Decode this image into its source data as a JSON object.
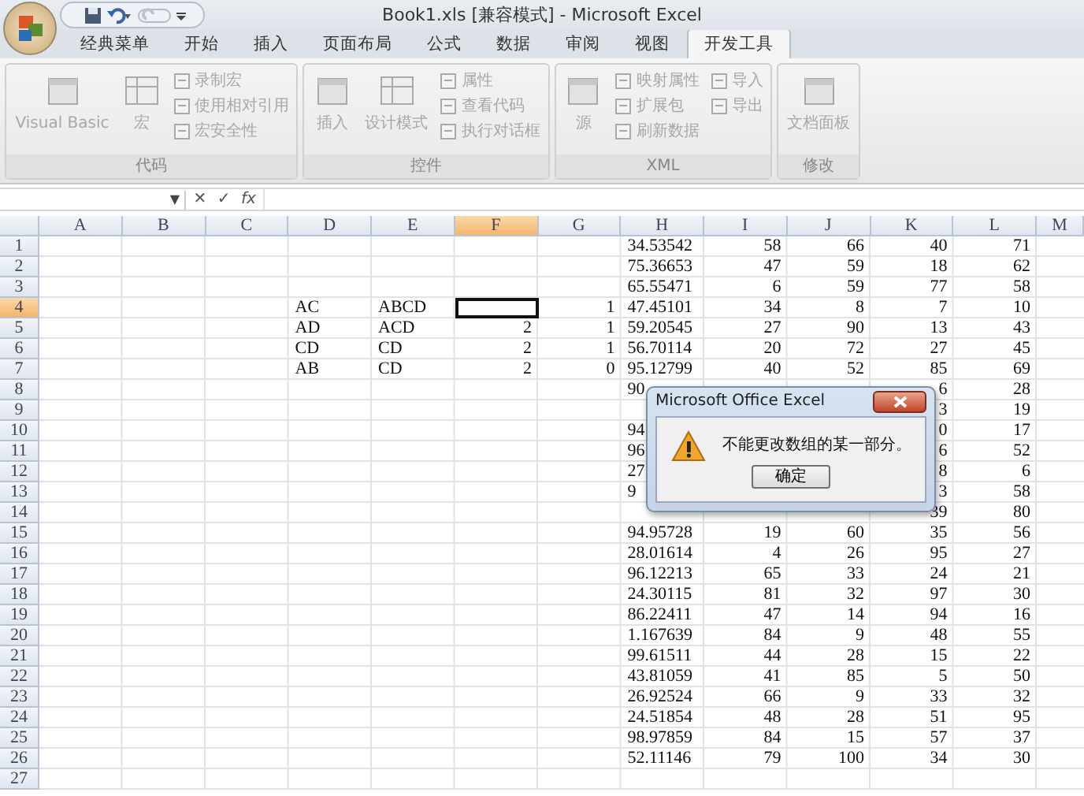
{
  "window": {
    "title": "Book1.xls  [兼容模式] - Microsoft Excel"
  },
  "tabs": [
    {
      "label": "经典菜单",
      "selected": false
    },
    {
      "label": "开始",
      "selected": false
    },
    {
      "label": "插入",
      "selected": false
    },
    {
      "label": "页面布局",
      "selected": false
    },
    {
      "label": "公式",
      "selected": false
    },
    {
      "label": "数据",
      "selected": false
    },
    {
      "label": "审阅",
      "selected": false
    },
    {
      "label": "视图",
      "selected": false
    },
    {
      "label": "开发工具",
      "selected": true
    }
  ],
  "ribbon": [
    {
      "title": "代码",
      "items": [
        {
          "label": "Visual Basic",
          "kind": "large",
          "disabled": true
        },
        {
          "label": "宏",
          "kind": "large",
          "disabled": true
        },
        {
          "label": "录制宏",
          "kind": "small",
          "disabled": true
        },
        {
          "label": "使用相对引用",
          "kind": "small",
          "disabled": true
        },
        {
          "label": "宏安全性",
          "kind": "small",
          "disabled": true
        }
      ]
    },
    {
      "title": "控件",
      "items": [
        {
          "label": "插入",
          "kind": "large",
          "disabled": true
        },
        {
          "label": "设计模式",
          "kind": "large",
          "disabled": true
        },
        {
          "label": "属性",
          "kind": "small",
          "disabled": true
        },
        {
          "label": "查看代码",
          "kind": "small",
          "disabled": true
        },
        {
          "label": "执行对话框",
          "kind": "small",
          "disabled": true
        }
      ]
    },
    {
      "title": "XML",
      "items": [
        {
          "label": "源",
          "kind": "large",
          "disabled": true
        },
        {
          "label": "映射属性",
          "kind": "small",
          "disabled": true
        },
        {
          "label": "扩展包",
          "kind": "small",
          "disabled": true
        },
        {
          "label": "刷新数据",
          "kind": "small",
          "disabled": true
        },
        {
          "label": "导入",
          "kind": "small",
          "disabled": true
        },
        {
          "label": "导出",
          "kind": "small",
          "disabled": true
        }
      ]
    },
    {
      "title": "修改",
      "items": [
        {
          "label": "文档面板",
          "kind": "large",
          "disabled": true
        }
      ]
    }
  ],
  "formula_bar": {
    "dropdown": "▼",
    "cancel": "✕",
    "enter": "✓",
    "fx": "fx"
  },
  "columns": [
    {
      "label": "A",
      "selected": false
    },
    {
      "label": "B",
      "selected": false
    },
    {
      "label": "C",
      "selected": false
    },
    {
      "label": "D",
      "selected": false
    },
    {
      "label": "E",
      "selected": false
    },
    {
      "label": "F",
      "selected": true
    },
    {
      "label": "G",
      "selected": false
    },
    {
      "label": "H",
      "selected": false
    },
    {
      "label": "I",
      "selected": false
    },
    {
      "label": "J",
      "selected": false
    },
    {
      "label": "K",
      "selected": false
    },
    {
      "label": "L",
      "selected": false
    },
    {
      "label": "M",
      "selected": false
    }
  ],
  "rows": [
    {
      "label": "1",
      "selected": false,
      "cells": {
        "H": "34.53542",
        "I": "58",
        "J": "66",
        "K": "40",
        "L": "71"
      }
    },
    {
      "label": "2",
      "selected": false,
      "cells": {
        "H": "75.36653",
        "I": "47",
        "J": "59",
        "K": "18",
        "L": "62"
      }
    },
    {
      "label": "3",
      "selected": false,
      "cells": {
        "H": "65.55471",
        "I": "6",
        "J": "59",
        "K": "77",
        "L": "58"
      }
    },
    {
      "label": "4",
      "selected": true,
      "cells": {
        "D": "AC",
        "E": "ABCD",
        "G": "1",
        "H": "47.45101",
        "I": "34",
        "J": "8",
        "K": "7",
        "L": "10"
      }
    },
    {
      "label": "5",
      "selected": false,
      "cells": {
        "D": "AD",
        "E": "ACD",
        "F": "2",
        "G": "1",
        "H": "59.20545",
        "I": "27",
        "J": "90",
        "K": "13",
        "L": "43"
      }
    },
    {
      "label": "6",
      "selected": false,
      "cells": {
        "D": "CD",
        "E": "CD",
        "F": "2",
        "G": "1",
        "H": "56.70114",
        "I": "20",
        "J": "72",
        "K": "27",
        "L": "45"
      }
    },
    {
      "label": "7",
      "selected": false,
      "cells": {
        "D": "AB",
        "E": "CD",
        "F": "2",
        "G": "0",
        "H": "95.12799",
        "I": "40",
        "J": "52",
        "K": "85",
        "L": "69"
      }
    },
    {
      "label": "8",
      "selected": false,
      "cells": {
        "H": "90",
        "K": "6",
        "L": "28"
      }
    },
    {
      "label": "9",
      "selected": false,
      "cells": {
        "K": "3",
        "L": "19"
      }
    },
    {
      "label": "10",
      "selected": false,
      "cells": {
        "H": "94",
        "K": "0",
        "L": "17"
      }
    },
    {
      "label": "11",
      "selected": false,
      "cells": {
        "H": "96",
        "K": "6",
        "L": "52"
      }
    },
    {
      "label": "12",
      "selected": false,
      "cells": {
        "H": "27",
        "K": "8",
        "L": "6"
      }
    },
    {
      "label": "13",
      "selected": false,
      "cells": {
        "H": "9",
        "K": "3",
        "L": "58"
      }
    },
    {
      "label": "14",
      "selected": false,
      "cells": {
        "K": "39",
        "L": "80"
      }
    },
    {
      "label": "15",
      "selected": false,
      "cells": {
        "H": "94.95728",
        "I": "19",
        "J": "60",
        "K": "35",
        "L": "56"
      }
    },
    {
      "label": "16",
      "selected": false,
      "cells": {
        "H": "28.01614",
        "I": "4",
        "J": "26",
        "K": "95",
        "L": "27"
      }
    },
    {
      "label": "17",
      "selected": false,
      "cells": {
        "H": "96.12213",
        "I": "65",
        "J": "33",
        "K": "24",
        "L": "21"
      }
    },
    {
      "label": "18",
      "selected": false,
      "cells": {
        "H": "24.30115",
        "I": "81",
        "J": "32",
        "K": "97",
        "L": "30"
      }
    },
    {
      "label": "19",
      "selected": false,
      "cells": {
        "H": "86.22411",
        "I": "47",
        "J": "14",
        "K": "94",
        "L": "16"
      }
    },
    {
      "label": "20",
      "selected": false,
      "cells": {
        "H": "1.167639",
        "I": "84",
        "J": "9",
        "K": "48",
        "L": "55"
      }
    },
    {
      "label": "21",
      "selected": false,
      "cells": {
        "H": "99.61511",
        "I": "44",
        "J": "28",
        "K": "15",
        "L": "22"
      }
    },
    {
      "label": "22",
      "selected": false,
      "cells": {
        "H": "43.81059",
        "I": "41",
        "J": "85",
        "K": "5",
        "L": "50"
      }
    },
    {
      "label": "23",
      "selected": false,
      "cells": {
        "H": "26.92524",
        "I": "66",
        "J": "9",
        "K": "33",
        "L": "32"
      }
    },
    {
      "label": "24",
      "selected": false,
      "cells": {
        "H": "24.51854",
        "I": "48",
        "J": "28",
        "K": "51",
        "L": "95"
      }
    },
    {
      "label": "25",
      "selected": false,
      "cells": {
        "H": "98.97859",
        "I": "84",
        "J": "15",
        "K": "57",
        "L": "37"
      }
    },
    {
      "label": "26",
      "selected": false,
      "cells": {
        "H": "52.11146",
        "I": "79",
        "J": "100",
        "K": "34",
        "L": "30"
      }
    },
    {
      "label": "27",
      "selected": false,
      "cells": {}
    }
  ],
  "dialog": {
    "title": "Microsoft Office Excel",
    "message": "不能更改数组的某一部分。",
    "button": "确定"
  }
}
